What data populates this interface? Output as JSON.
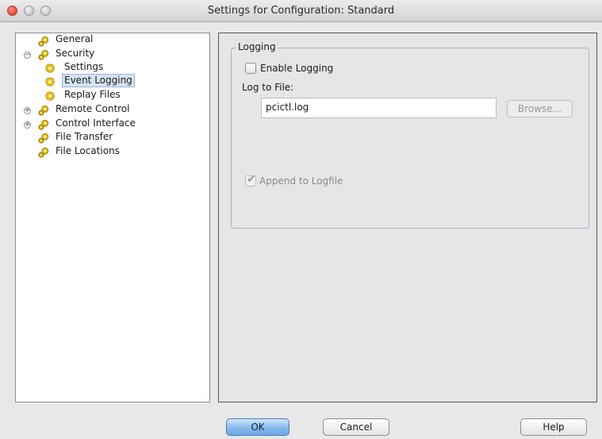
{
  "window": {
    "title": "Settings for Configuration: Standard"
  },
  "tree": {
    "items": [
      {
        "label": "General"
      },
      {
        "label": "Security",
        "expanded": true
      },
      {
        "label": "Settings"
      },
      {
        "label": "Event Logging",
        "selected": true
      },
      {
        "label": "Replay Files"
      },
      {
        "label": "Remote Control",
        "expanded": false
      },
      {
        "label": "Control Interface",
        "expanded": false
      },
      {
        "label": "File Transfer"
      },
      {
        "label": "File Locations"
      }
    ]
  },
  "logging": {
    "group_title": "Logging",
    "enable_logging_label": "Enable Logging",
    "enable_logging_checked": false,
    "log_to_file_label": "Log to File:",
    "log_file_value": "pcictl.log",
    "browse_label": "Browse...",
    "append_label": "Append to Logfile",
    "append_checked": true,
    "append_enabled": false
  },
  "buttons": {
    "ok": "OK",
    "cancel": "Cancel",
    "help": "Help"
  },
  "colors": {
    "default_button": "#86b9ec",
    "selection": "#d5e2f5",
    "close_button": "#e0443e"
  }
}
